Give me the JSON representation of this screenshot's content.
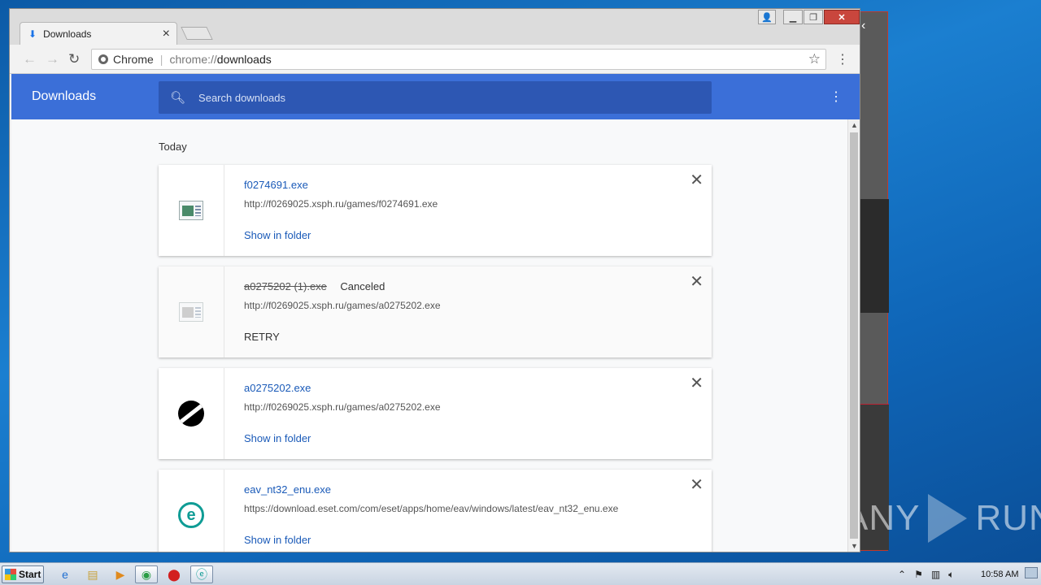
{
  "browser": {
    "tab_title": "Downloads",
    "omnibox_site_label": "Chrome",
    "url_scheme": "chrome://",
    "url_path": "downloads"
  },
  "downloads_page": {
    "title": "Downloads",
    "search_placeholder": "Search downloads",
    "date_group": "Today",
    "items": [
      {
        "filename": "f0274691.exe",
        "status": "",
        "source_url": "http://f0269025.xsph.ru/games/f0274691.exe",
        "action": "Show in folder",
        "icon": "exe-file-icon"
      },
      {
        "filename": "a0275202 (1).exe",
        "status": "Canceled",
        "source_url": "http://f0269025.xsph.ru/games/a0275202.exe",
        "action": "RETRY",
        "icon": "exe-file-icon"
      },
      {
        "filename": "a0275202.exe",
        "status": "",
        "source_url": "http://f0269025.xsph.ru/games/a0275202.exe",
        "action": "Show in folder",
        "icon": "app-s-logo-icon"
      },
      {
        "filename": "eav_nt32_enu.exe",
        "status": "",
        "source_url": "https://download.eset.com/com/eset/apps/home/eav/windows/latest/eav_nt32_enu.exe",
        "action": "Show in folder",
        "icon": "eset-logo-icon"
      }
    ]
  },
  "taskbar": {
    "start_label": "Start",
    "clock": "10:58 AM"
  },
  "desktop": {
    "watermark_left": "ANY",
    "watermark_right": "RUN"
  },
  "colors": {
    "header_blue": "#3b6fd8",
    "link_blue": "#1a5ab8",
    "close_red": "#c9463d"
  }
}
